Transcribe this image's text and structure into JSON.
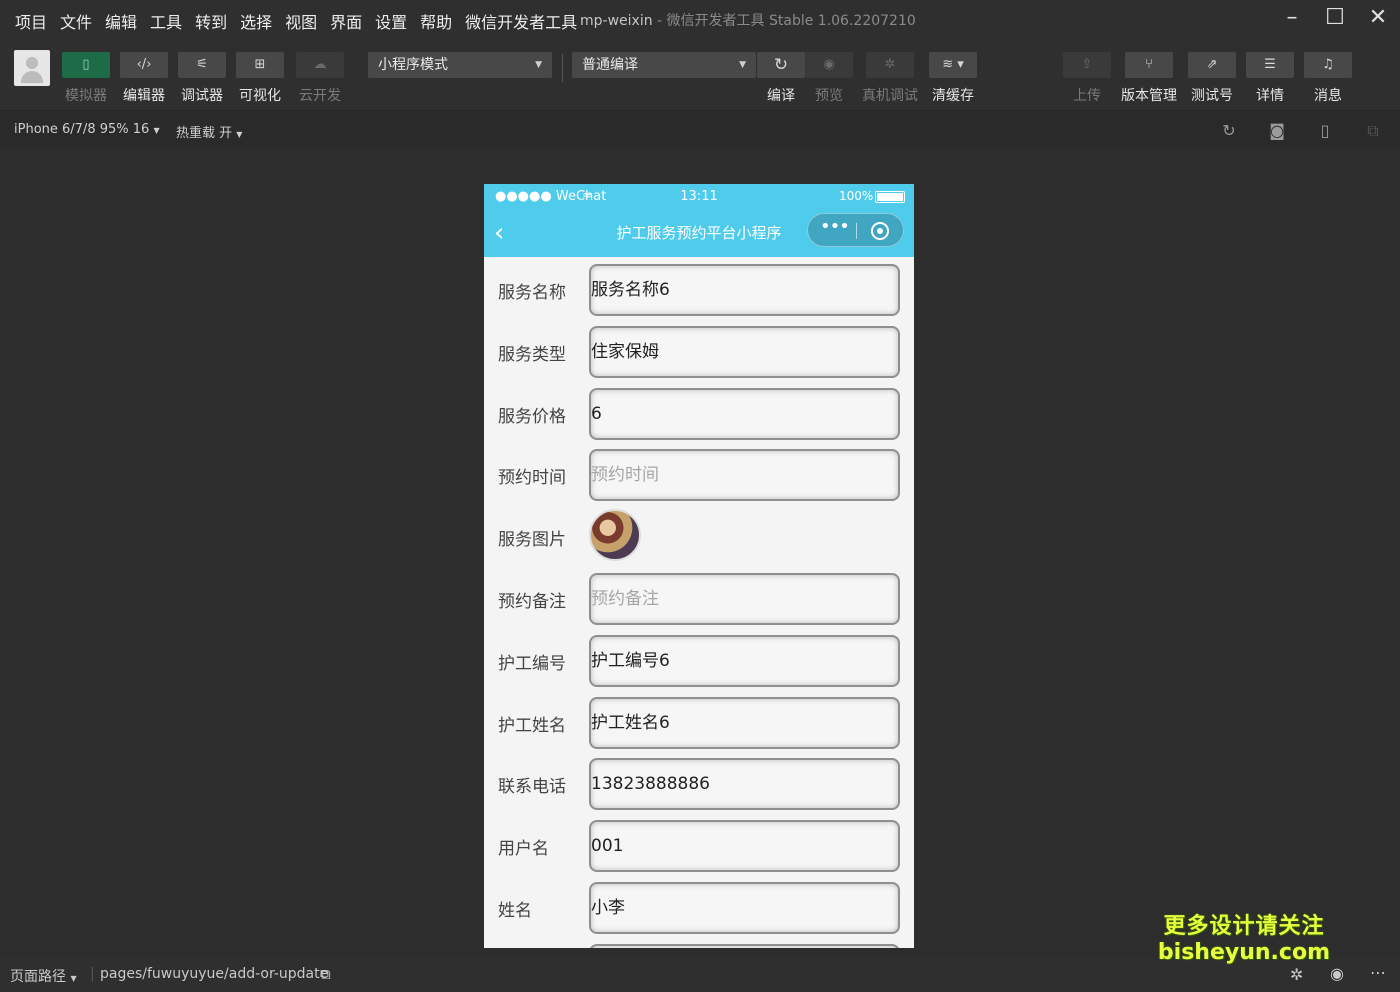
{
  "menubar": {
    "items": [
      "项目",
      "文件",
      "编辑",
      "工具",
      "转到",
      "选择",
      "视图",
      "界面",
      "设置",
      "帮助",
      "微信开发者工具"
    ],
    "app_name": "mp-weixin",
    "separator": "-",
    "subtitle": "微信开发者工具 Stable 1.06.2207210"
  },
  "toolbar": {
    "left_buttons": [
      {
        "label": "模拟器",
        "icon": "phone-icon",
        "state": "active"
      },
      {
        "label": "编辑器",
        "icon": "code-icon",
        "state": "normal"
      },
      {
        "label": "调试器",
        "icon": "debug-icon",
        "state": "normal"
      },
      {
        "label": "可视化",
        "icon": "layout-icon",
        "state": "normal"
      },
      {
        "label": "云开发",
        "icon": "cloud-icon",
        "state": "disabled"
      }
    ],
    "mode_select": "小程序模式",
    "compile_select": "普通编译",
    "mid_buttons": [
      {
        "label": "编译",
        "icon": "refresh-icon",
        "state": "normal"
      },
      {
        "label": "预览",
        "icon": "eye-icon",
        "state": "disabled"
      },
      {
        "label": "真机调试",
        "icon": "bug-icon",
        "state": "disabled"
      },
      {
        "label": "清缓存",
        "icon": "layers-icon",
        "state": "normal"
      }
    ],
    "right_buttons": [
      {
        "label": "上传",
        "icon": "upload-icon",
        "state": "disabled"
      },
      {
        "label": "版本管理",
        "icon": "branch-icon",
        "state": "normal"
      },
      {
        "label": "测试号",
        "icon": "external-icon",
        "state": "normal"
      },
      {
        "label": "详情",
        "icon": "menu-icon",
        "state": "normal"
      },
      {
        "label": "消息",
        "icon": "bell-icon",
        "state": "normal"
      }
    ]
  },
  "subbar": {
    "device": "iPhone 6/7/8 95% 16",
    "hot_reload": "热重载 开"
  },
  "phone": {
    "carrier": "●●●●● WeChat",
    "time": "13:11",
    "battery": "100%",
    "title": "护工服务预约平台小程序"
  },
  "form": [
    {
      "label": "服务名称",
      "value": "服务名称6",
      "placeholder": false
    },
    {
      "label": "服务类型",
      "value": "住家保姆",
      "placeholder": false
    },
    {
      "label": "服务价格",
      "value": "6",
      "placeholder": false
    },
    {
      "label": "预约时间",
      "value": "预约时间",
      "placeholder": true
    },
    {
      "label": "服务图片",
      "value": "",
      "placeholder": false,
      "image": true
    },
    {
      "label": "预约备注",
      "value": "预约备注",
      "placeholder": true
    },
    {
      "label": "护工编号",
      "value": "护工编号6",
      "placeholder": false
    },
    {
      "label": "护工姓名",
      "value": "护工姓名6",
      "placeholder": false
    },
    {
      "label": "联系电话",
      "value": "13823888886",
      "placeholder": false
    },
    {
      "label": "用户名",
      "value": "001",
      "placeholder": false
    },
    {
      "label": "姓名",
      "value": "小李",
      "placeholder": false
    }
  ],
  "bottombar": {
    "path_label": "页面路径",
    "path": "pages/fuwuyuyue/add-or-update"
  },
  "watermark": {
    "line1": "更多设计请关注",
    "line2": "bisheyun.com"
  },
  "colors": {
    "accent": "#4fcbec",
    "active_green": "#1d6b47",
    "watermark": "#e7ff3d"
  }
}
